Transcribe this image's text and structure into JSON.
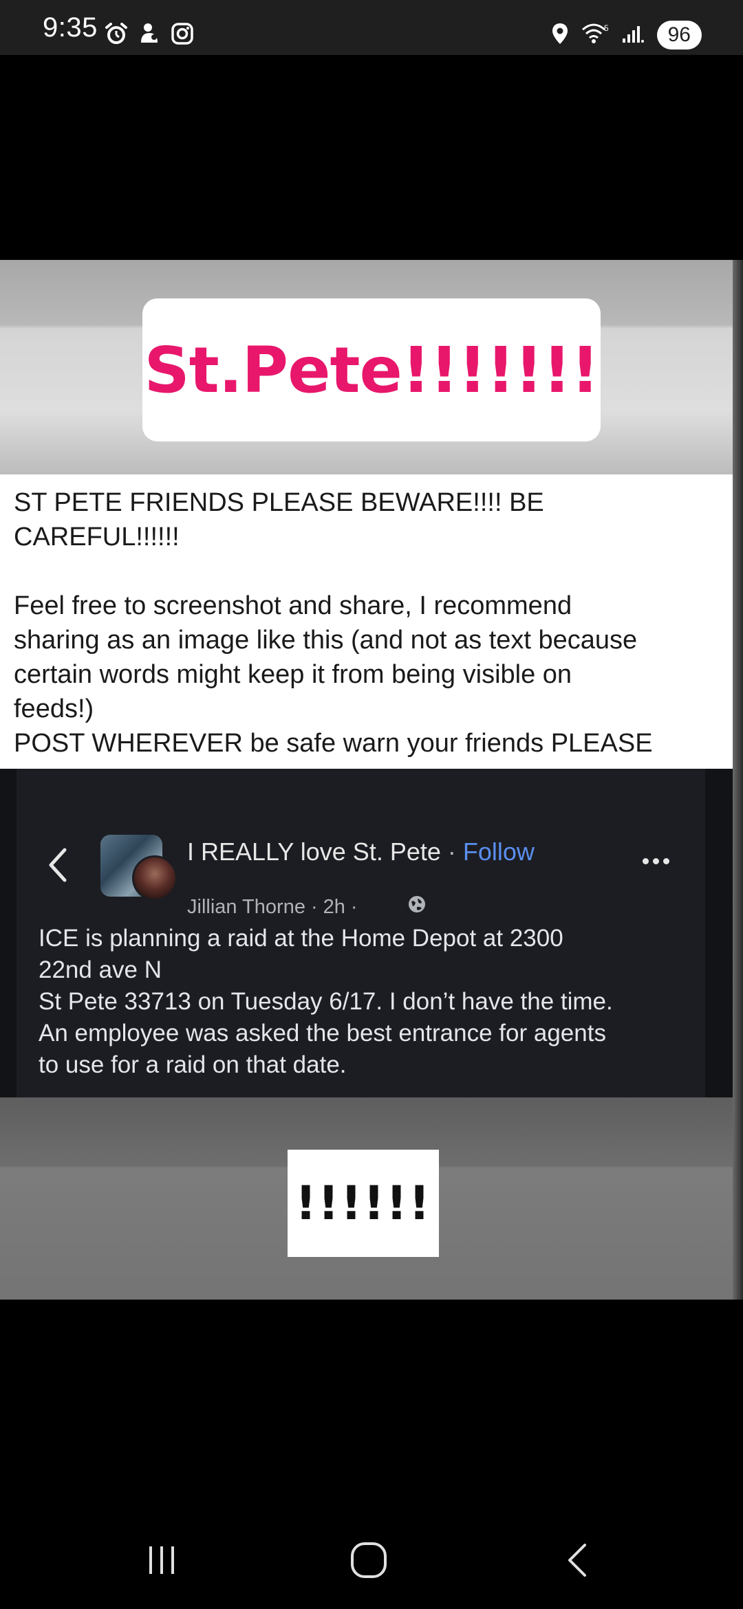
{
  "status_bar": {
    "time": "9:35",
    "battery": "96",
    "left_icons": [
      "alarm-icon",
      "app-notification-icon",
      "instagram-icon"
    ],
    "right_icons": [
      "location-icon",
      "wifi-icon",
      "signal-icon"
    ]
  },
  "shared_image": {
    "title": "St.Pete!!!!!!!",
    "caption_lines": [
      "ST PETE FRIENDS PLEASE BEWARE!!!! BE",
      "CAREFUL!!!!!!",
      "",
      "Feel free to screenshot and share, I recommend",
      "sharing as an image like this (and not as text because",
      "certain words might keep it from being visible on",
      "feeds!)",
      "POST WHEREVER be safe warn your friends PLEASE"
    ],
    "post": {
      "group_name": "I REALLY love St. Pete",
      "separator": " · ",
      "follow_label": "Follow",
      "author": "Jillian Thorne",
      "time_ago": "2h",
      "body_lines": [
        "ICE is planning a raid at the Home Depot at 2300",
        "22nd ave N",
        "St Pete 33713 on Tuesday 6/17. I don’t have the time.",
        "An employee was asked the best entrance for agents",
        "to use for a raid on that date."
      ]
    },
    "bottom_label": "!!!!!!"
  },
  "nav_bar": {
    "buttons": [
      "recent-apps",
      "home",
      "back"
    ]
  }
}
